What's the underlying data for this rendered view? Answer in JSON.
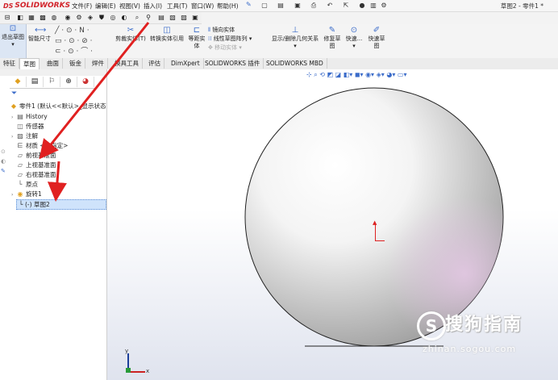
{
  "app": {
    "logo_text": "SOLIDWORKS",
    "logo_prefix": "DS",
    "document_title": "草图2 - 零件1 *"
  },
  "menu": [
    "文件(F)",
    "编辑(E)",
    "视图(V)",
    "插入(I)",
    "工具(T)",
    "窗口(W)",
    "帮助(H)"
  ],
  "ribbon": {
    "exit_sketch": "退出草图",
    "smart_dimension": "智能尺寸",
    "cut_entities": "剪裁实体(T)",
    "convert_entities": "转换实体引用",
    "offset_entities": [
      "等距实",
      "体"
    ],
    "mirror_entities": "镜向实体",
    "linear_pattern": "线性草图阵列",
    "move_entities": "移动实体",
    "display_relations": "显示/删除几何关系",
    "repair_sketch": [
      "修复草",
      "图"
    ],
    "quick_snaps": [
      "快速..."
    ],
    "rapid_sketch": [
      "快速草",
      "图"
    ]
  },
  "tabs": [
    "特征",
    "草图",
    "曲面",
    "钣金",
    "焊件",
    "模具工具",
    "评估",
    "DimXpert",
    "SOLIDWORKS 插件",
    "SOLIDWORKS MBD"
  ],
  "active_tab": "草图",
  "tree": {
    "root": "零件1 (默认<<默认>_显示状态",
    "items": [
      {
        "label": "History",
        "icon": "history-icon"
      },
      {
        "label": "传感器",
        "icon": "sensor-icon"
      },
      {
        "label": "注解",
        "icon": "annotation-icon"
      },
      {
        "label": "材质 <未指定>",
        "icon": "material-icon"
      },
      {
        "label": "前视基准面",
        "icon": "plane-icon"
      },
      {
        "label": "上视基准面",
        "icon": "plane-icon"
      },
      {
        "label": "右视基准面",
        "icon": "plane-icon"
      },
      {
        "label": "原点",
        "icon": "origin-icon"
      },
      {
        "label": "旋转1",
        "icon": "revolve-icon"
      },
      {
        "label": "(-) 草图2",
        "icon": "sketch-icon"
      }
    ]
  },
  "axis": {
    "x": "x",
    "y": "y"
  },
  "watermark": {
    "text": "搜狗指南",
    "url": "zhinan.sogou.com",
    "glyph": "S"
  },
  "colors": {
    "brand_red": "#d2232a",
    "selection_blue": "#cfe3fb",
    "arrow_red": "#e02020"
  }
}
